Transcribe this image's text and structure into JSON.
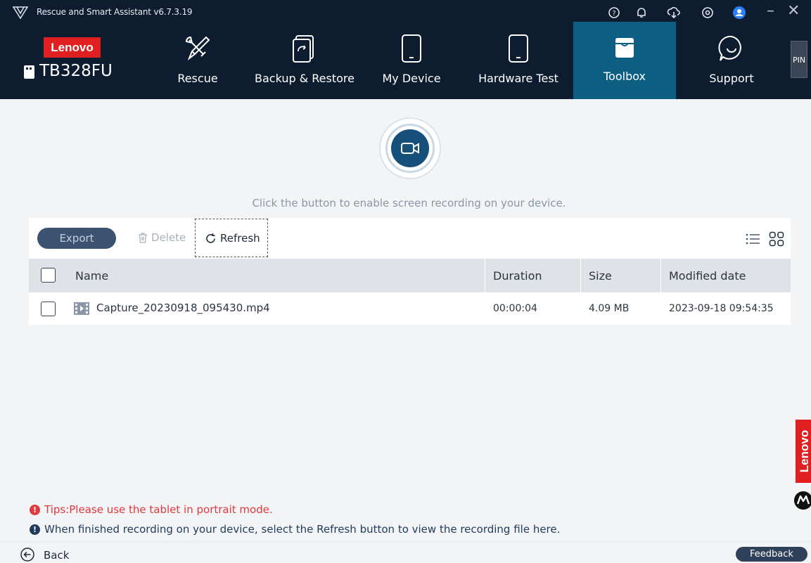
{
  "window": {
    "title": "Rescue and Smart Assistant v6.7.3.19",
    "controls": [
      "help-icon",
      "bell-icon",
      "cloud-download-icon",
      "settings-icon",
      "user-icon",
      "minimize-icon",
      "close-icon"
    ]
  },
  "brand": {
    "logo_text": "Lenovo",
    "device_name": "TB328FU",
    "pin_label": "PIN",
    "side_badge_text": "Lenovo"
  },
  "nav": {
    "tabs": [
      {
        "label": "Rescue",
        "icon": "tools-icon"
      },
      {
        "label": "Backup & Restore",
        "icon": "backup-icon"
      },
      {
        "label": "My Device",
        "icon": "tablet-icon"
      },
      {
        "label": "Hardware Test",
        "icon": "tablet-test-icon"
      },
      {
        "label": "Toolbox",
        "icon": "toolbox-icon",
        "active": true
      },
      {
        "label": "Support",
        "icon": "chat-icon"
      }
    ]
  },
  "main": {
    "record_hint": "Click the button to enable screen recording on your device.",
    "toolbar": {
      "export_label": "Export",
      "delete_label": "Delete",
      "refresh_label": "Refresh"
    },
    "table": {
      "columns": [
        "Name",
        "Duration",
        "Size",
        "Modified date"
      ],
      "rows": [
        {
          "name": "Capture_20230918_095430.mp4",
          "duration": "00:00:04",
          "size": "4.09 MB",
          "modified": "2023-09-18 09:54:35"
        }
      ]
    }
  },
  "tips": {
    "tip1": "Tips:Please use the tablet in portrait mode.",
    "tip2": "When finished recording on your device, select the Refresh button to view the recording file here."
  },
  "footer": {
    "back_label": "Back",
    "feedback_label": "Feedback"
  },
  "colors": {
    "header_bg": "#0d1c2e",
    "active_tab": "#0c5e82",
    "record_button": "#16507a",
    "brand_red": "#e02020",
    "tip_red": "#e0393e"
  }
}
